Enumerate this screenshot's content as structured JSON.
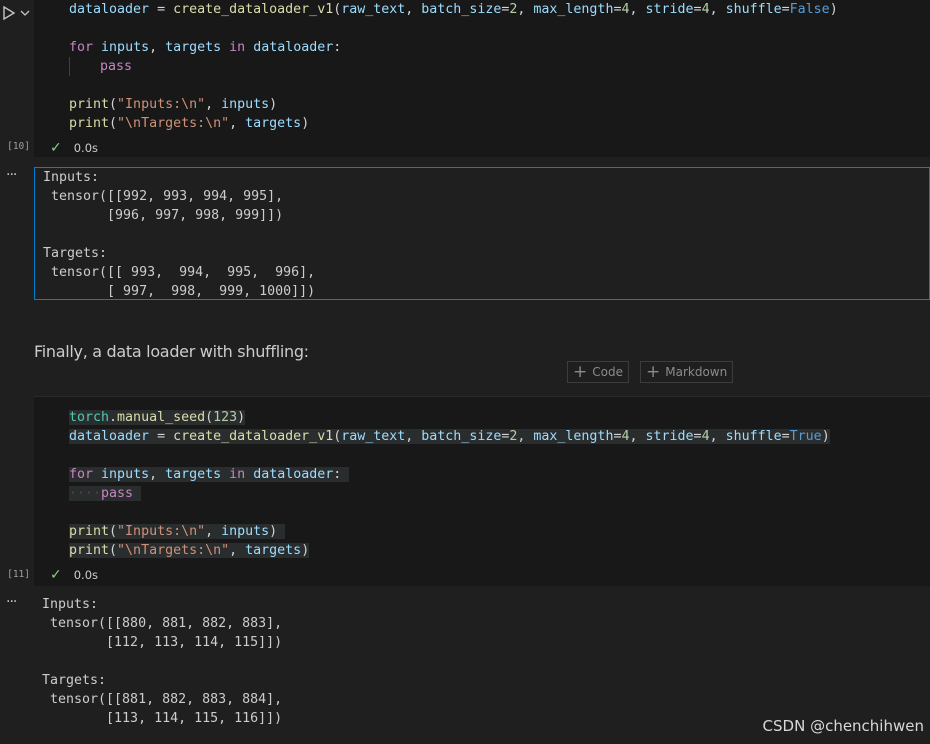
{
  "cell1": {
    "exec_count": "[10]",
    "status_time": "0.0s",
    "line1": {
      "a": "dataloader",
      "b": " = ",
      "c": "create_dataloader_v1",
      "d": "(",
      "e": "raw_text",
      "f": ", ",
      "g": "batch_size",
      "h": "=",
      "i": "2",
      "j": ", ",
      "k": "max_length",
      "l": "=",
      "m": "4",
      "n": ", ",
      "o": "stride",
      "p": "=",
      "q": "4",
      "r": ", ",
      "s": "shuffle",
      "t": "=",
      "u": "False",
      "v": ")"
    },
    "line2": {
      "a": "for",
      "b": " ",
      "c": "inputs",
      "d": ", ",
      "e": "targets",
      "f": " ",
      "g": "in",
      "h": " ",
      "i": "dataloader",
      "j": ":"
    },
    "line3": {
      "a": "pass"
    },
    "line4": {
      "a": "print",
      "b": "(",
      "c": "\"Inputs:\\n\"",
      "d": ", ",
      "e": "inputs",
      "f": ")"
    },
    "line5": {
      "a": "print",
      "b": "(",
      "c": "\"\\nTargets:\\n\"",
      "d": ", ",
      "e": "targets",
      "f": ")"
    }
  },
  "output1": {
    "lines": [
      "Inputs:",
      " tensor([[992, 993, 994, 995],",
      "        [996, 997, 998, 999]])",
      "",
      "Targets:",
      " tensor([[ 993,  994,  995,  996],",
      "        [ 997,  998,  999, 1000]])"
    ]
  },
  "markdown": {
    "text": "Finally, a data loader with shuffling:"
  },
  "toolbar": {
    "code_label": "Code",
    "markdown_label": "Markdown"
  },
  "cell2": {
    "exec_count": "[11]",
    "status_time": "0.0s",
    "line0": {
      "a": "torch",
      "b": ".",
      "c": "manual_seed",
      "d": "(",
      "e": "123",
      "f": ")"
    },
    "line1": {
      "a": "dataloader",
      "b": " = ",
      "c": "create_dataloader_v1",
      "d": "(",
      "e": "raw_text",
      "f": ", ",
      "g": "batch_size",
      "h": "=",
      "i": "2",
      "j": ", ",
      "k": "max_length",
      "l": "=",
      "m": "4",
      "n": ", ",
      "o": "stride",
      "p": "=",
      "q": "4",
      "r": ", ",
      "s": "shuffle",
      "t": "=",
      "u": "True",
      "v": ")"
    },
    "line2": {
      "a": "for",
      "b": " ",
      "c": "inputs",
      "d": ", ",
      "e": "targets",
      "f": " ",
      "g": "in",
      "h": " ",
      "i": "dataloader",
      "j": ":"
    },
    "line3": {
      "a": "pass"
    },
    "line4": {
      "a": "print",
      "b": "(",
      "c": "\"Inputs:\\n\"",
      "d": ", ",
      "e": "inputs",
      "f": ")"
    },
    "line5": {
      "a": "print",
      "b": "(",
      "c": "\"\\nTargets:\\n\"",
      "d": ", ",
      "e": "targets",
      "f": ")"
    }
  },
  "output2": {
    "lines": [
      "Inputs:",
      " tensor([[880, 881, 882, 883],",
      "        [112, 113, 114, 115]])",
      "",
      "Targets:",
      " tensor([[881, 882, 883, 884],",
      "        [113, 114, 115, 116]])"
    ]
  },
  "watermark": "CSDN @chenchihwen",
  "icons": {
    "run": "play-icon",
    "chevron": "chevron-down-icon",
    "check": "check-icon",
    "more": "ellipsis-icon",
    "plus": "plus-icon"
  },
  "colors": {
    "accent": "#007fd4",
    "success": "#89d185",
    "background": "#1f1f1f"
  }
}
